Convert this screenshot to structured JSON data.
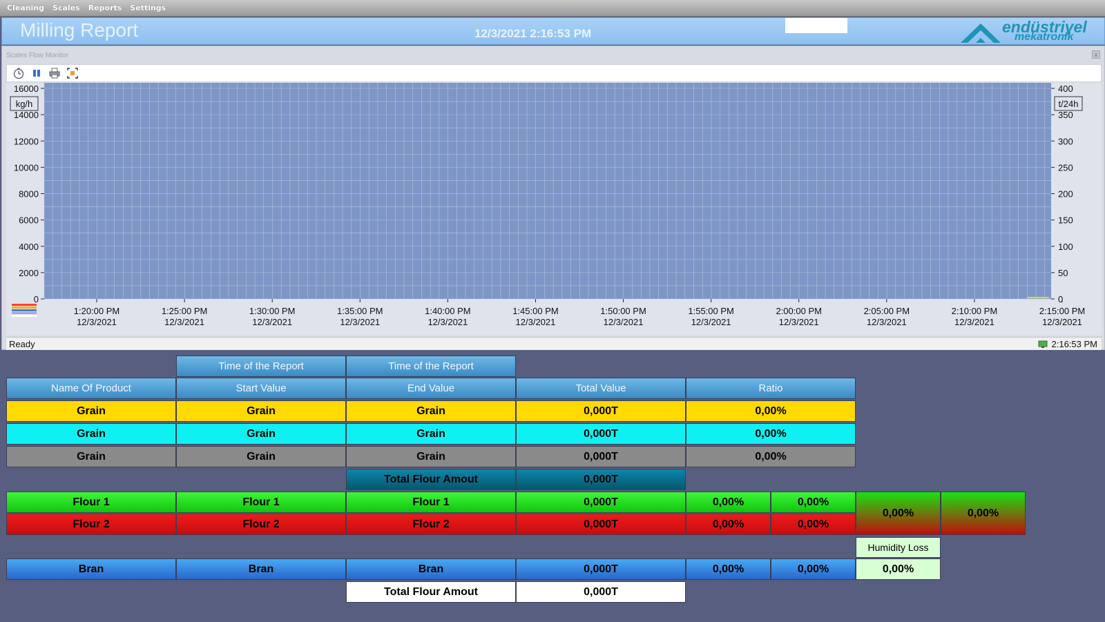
{
  "menu": [
    "Cleaning",
    "Scales",
    "Reports",
    "Settings"
  ],
  "header": {
    "title": "Milling Report",
    "datetime": "12/3/2021 2:16:53 PM",
    "logo_line1": "endüstriyel",
    "logo_line2": "mekatronik"
  },
  "panel": {
    "caption": "Scales Flow Monitor",
    "close": "x",
    "status": "Ready",
    "status_time": "2:16:53 PM"
  },
  "colors": {
    "chart_bg": "#7e96c6",
    "grid": "#b4c3e0"
  },
  "chart_data": {
    "type": "line",
    "ylabel": "kg/h",
    "y2label": "t/24h",
    "ylim": [
      0,
      16000
    ],
    "y2lim": [
      0,
      400
    ],
    "yticks": [
      0,
      2000,
      4000,
      6000,
      8000,
      10000,
      12000,
      14000,
      16000
    ],
    "y2ticks": [
      0,
      50,
      100,
      150,
      200,
      250,
      300,
      350,
      400
    ],
    "xticks": [
      {
        "time": "1:20:00 PM",
        "date": "12/3/2021"
      },
      {
        "time": "1:25:00 PM",
        "date": "12/3/2021"
      },
      {
        "time": "1:30:00 PM",
        "date": "12/3/2021"
      },
      {
        "time": "1:35:00 PM",
        "date": "12/3/2021"
      },
      {
        "time": "1:40:00 PM",
        "date": "12/3/2021"
      },
      {
        "time": "1:45:00 PM",
        "date": "12/3/2021"
      },
      {
        "time": "1:50:00 PM",
        "date": "12/3/2021"
      },
      {
        "time": "1:55:00 PM",
        "date": "12/3/2021"
      },
      {
        "time": "2:00:00 PM",
        "date": "12/3/2021"
      },
      {
        "time": "2:05:00 PM",
        "date": "12/3/2021"
      },
      {
        "time": "2:10:00 PM",
        "date": "12/3/2021"
      },
      {
        "time": "2:15:00 PM",
        "date": "12/3/2021"
      }
    ],
    "series": []
  },
  "table": {
    "time_of_report": "Time of the Report",
    "headers": [
      "Name Of Product",
      "Start Value",
      "End Value",
      "Total Value",
      "Ratio"
    ],
    "grain_rows": [
      [
        "Grain",
        "Grain",
        "Grain",
        "0,000T",
        "0,00%"
      ],
      [
        "Grain",
        "Grain",
        "Grain",
        "0,000T",
        "0,00%"
      ],
      [
        "Grain",
        "Grain",
        "Grain",
        "0,000T",
        "0,00%"
      ]
    ],
    "total_flour_label": "Total Flour Amout",
    "total_flour_value": "0,000T",
    "flour_rows": [
      [
        "Flour 1",
        "Flour 1",
        "Flour 1",
        "0,000T",
        "0,00%",
        "0,00%"
      ],
      [
        "Flour 2",
        "Flour 2",
        "Flour 2",
        "0,000T",
        "0,00%",
        "0,00%"
      ]
    ],
    "flour_combined": [
      "0,00%",
      "0,00%"
    ],
    "humidity_label": "Humidity Loss",
    "bran_row": [
      "Bran",
      "Bran",
      "Bran",
      "0,000T",
      "0,00%",
      "0,00%",
      "0,00%"
    ],
    "total_flour_label2": "Total Flour Amout",
    "total_flour_value2": "0,000T"
  }
}
